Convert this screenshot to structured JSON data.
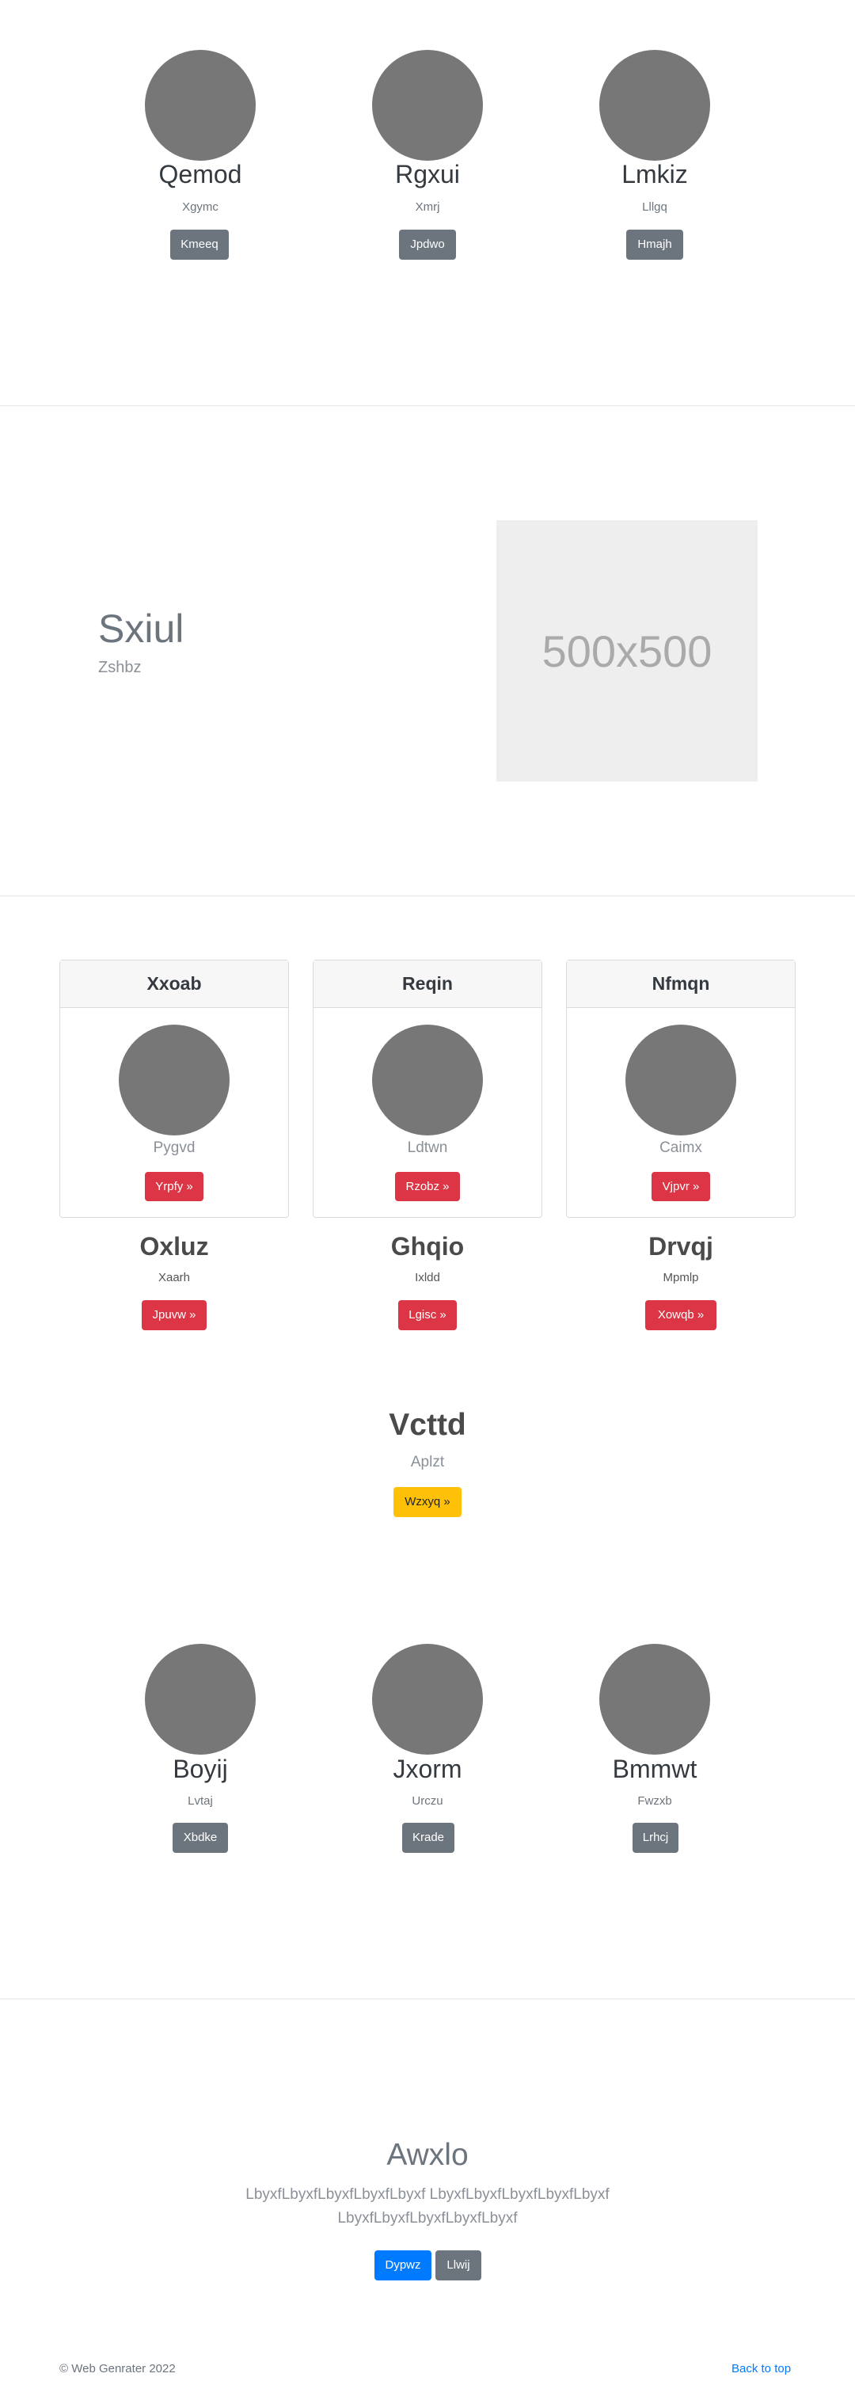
{
  "team_top": [
    {
      "name": "Qemod",
      "role": "Xgymc",
      "button": "Kmeeq"
    },
    {
      "name": "Rgxui",
      "role": "Xmrj",
      "button": "Jpdwo"
    },
    {
      "name": "Lmkiz",
      "role": "Lllgq",
      "button": "Hmajh"
    }
  ],
  "feature": {
    "title": "Sxiul",
    "subtitle": "Zshbz",
    "image_label": "500x500"
  },
  "cards": [
    {
      "header": "Xxoab",
      "caption": "Pygvd",
      "button": "Yrpfy »"
    },
    {
      "header": "Reqin",
      "caption": "Ldtwn",
      "button": "Rzobz »"
    },
    {
      "header": "Nfmqn",
      "caption": "Caimx",
      "button": "Vjpvr »"
    }
  ],
  "features_row": [
    {
      "title": "Oxluz",
      "text": "Xaarh",
      "button": "Jpuvw »"
    },
    {
      "title": "Ghqio",
      "text": "Ixldd",
      "button": "Lgisc »"
    },
    {
      "title": "Drvqj",
      "text": "Mpmlp",
      "button": "Xowqb »"
    }
  ],
  "cta": {
    "title": "Vcttd",
    "subtitle": "Aplzt",
    "button": "Wzxyq »"
  },
  "team_bottom": [
    {
      "name": "Boyij",
      "role": "Lvtaj",
      "button": "Xbdke"
    },
    {
      "name": "Jxorm",
      "role": "Urczu",
      "button": "Krade"
    },
    {
      "name": "Bmmwt",
      "role": "Fwzxb",
      "button": "Lrhcj"
    }
  ],
  "hero": {
    "title": "Awxlo",
    "text_line1": "LbyxfLbyxfLbyxfLbyxfLbyxf LbyxfLbyxfLbyxfLbyxfLbyxf",
    "text_line2": "LbyxfLbyxfLbyxfLbyxfLbyxf",
    "primary_button": "Dypwz",
    "secondary_button": "Llwij"
  },
  "footer": {
    "copyright": "© Web Genrater 2022",
    "back_to_top": "Back to top"
  },
  "colors": {
    "avatar": "#777777",
    "danger": "#dc3545",
    "warning": "#ffc107",
    "primary": "#007bff",
    "secondary": "#6c757d"
  }
}
